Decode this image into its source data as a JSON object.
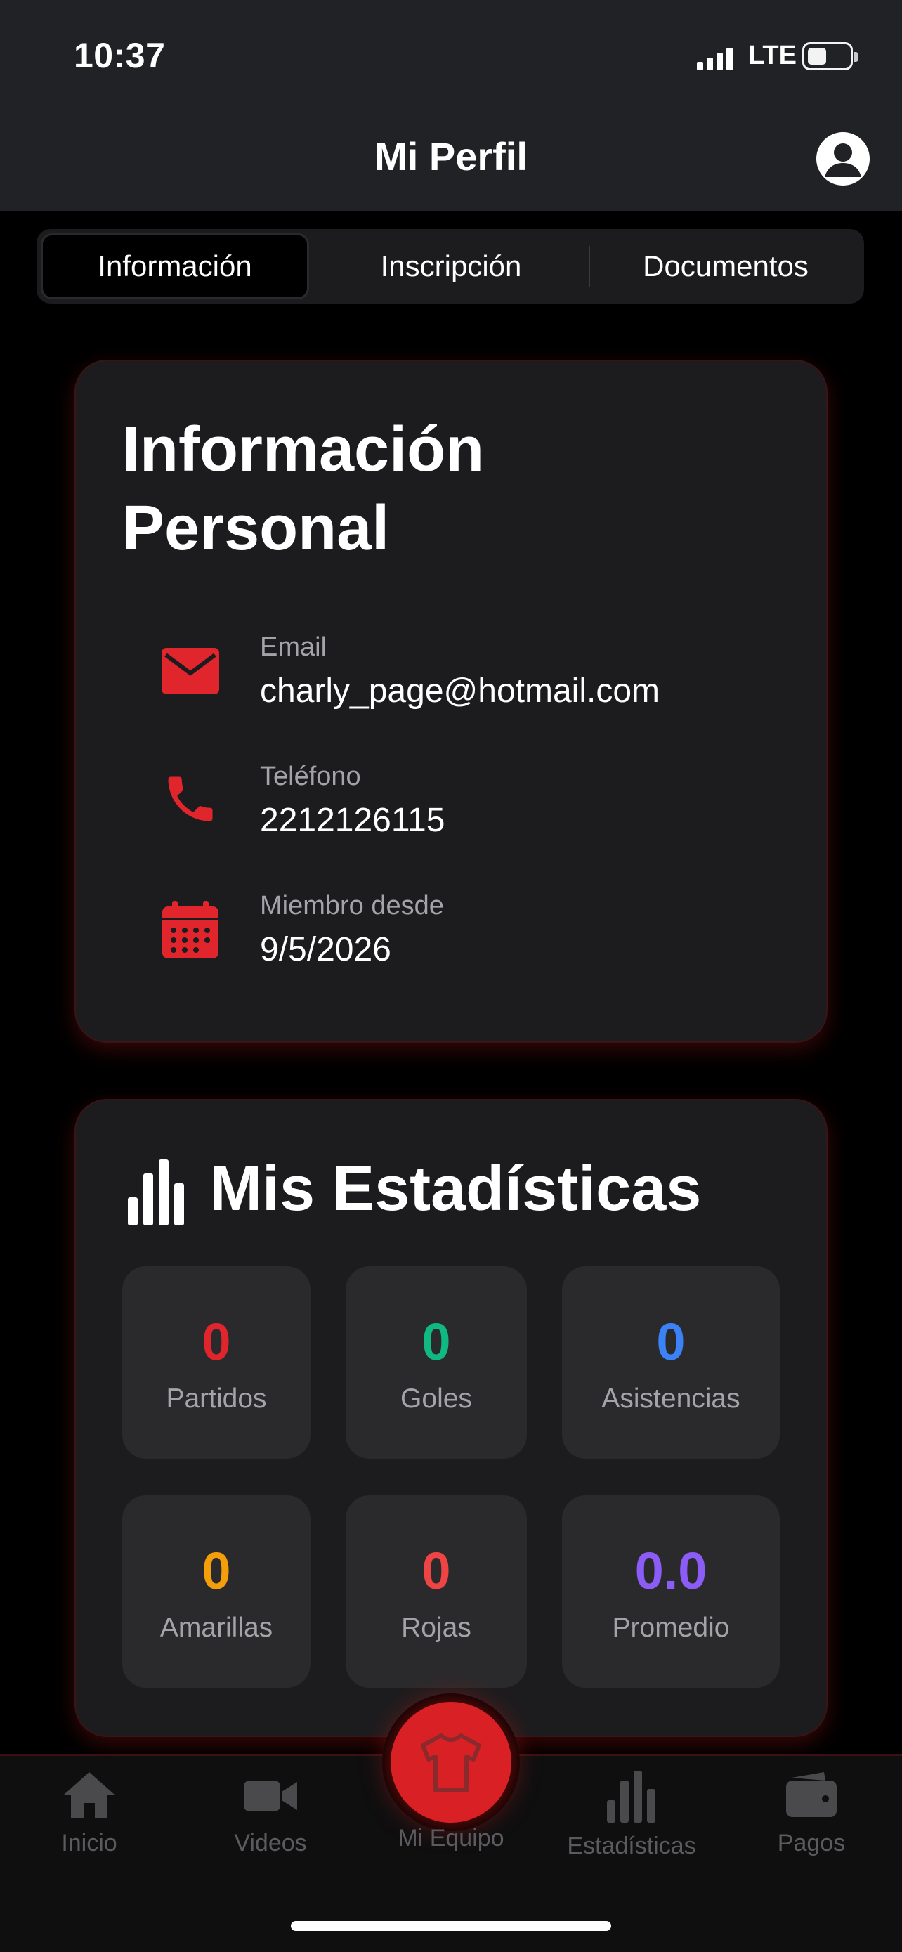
{
  "status_bar": {
    "time": "10:37",
    "network": "LTE"
  },
  "header": {
    "title": "Mi Perfil"
  },
  "tabs": [
    {
      "label": "Información",
      "active": true
    },
    {
      "label": "Inscripción",
      "active": false
    },
    {
      "label": "Documentos",
      "active": false
    }
  ],
  "personal_info": {
    "title_line1": "Información",
    "title_line2": "Personal",
    "items": [
      {
        "label": "Email",
        "value": "charly_page@hotmail.com",
        "icon": "envelope-icon"
      },
      {
        "label": "Teléfono",
        "value": "2212126115",
        "icon": "phone-icon"
      },
      {
        "label": "Miembro desde",
        "value": "9/5/2026",
        "icon": "calendar-icon"
      }
    ]
  },
  "stats": {
    "title": "Mis Estadísticas",
    "items": [
      {
        "value": "0",
        "label": "Partidos",
        "color": "#e0262c"
      },
      {
        "value": "0",
        "label": "Goles",
        "color": "#10b981"
      },
      {
        "value": "0",
        "label": "Asistencias",
        "color": "#3b82f6"
      },
      {
        "value": "0",
        "label": "Amarillas",
        "color": "#f59e0b"
      },
      {
        "value": "0",
        "label": "Rojas",
        "color": "#ef4444"
      },
      {
        "value": "0.0",
        "label": "Promedio",
        "color": "#8b5cf6"
      }
    ]
  },
  "bottom_nav": {
    "items": [
      {
        "label": "Inicio",
        "icon": "home-icon"
      },
      {
        "label": "Videos",
        "icon": "video-icon"
      },
      {
        "label": "Mi Equipo",
        "icon": "shirt-icon",
        "active": true
      },
      {
        "label": "Estadísticas",
        "icon": "bar-chart-icon"
      },
      {
        "label": "Pagos",
        "icon": "wallet-icon"
      }
    ]
  },
  "colors": {
    "accent": "#d92025",
    "background": "#000000",
    "card": "#1c1c1e"
  }
}
